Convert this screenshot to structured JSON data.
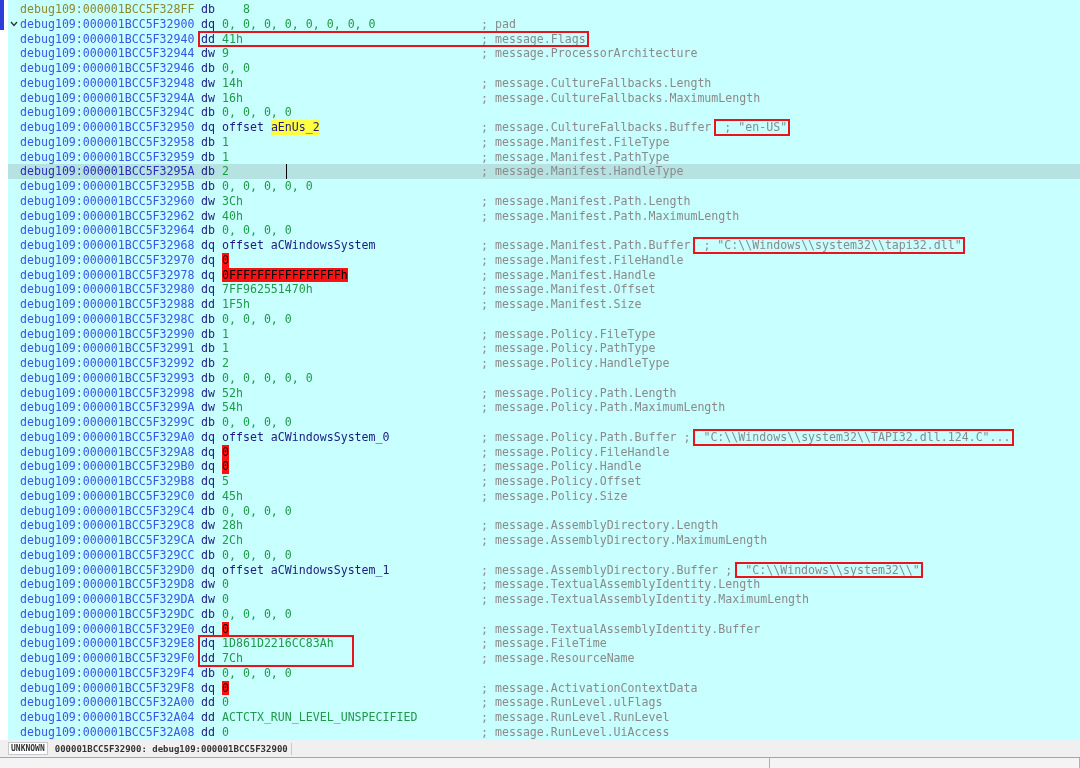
{
  "listing": [
    {
      "address": "debug109:000001BCC5F328FF",
      "mnemonic": "db",
      "operand": [
        {
          "text": "   8",
          "kind": "number"
        }
      ],
      "boxed_code": false,
      "boxed_comment": false,
      "boxed_string": false,
      "selected": false,
      "dimmed": true
    },
    {
      "address": "debug109:000001BCC5F32900",
      "mnemonic": "dq",
      "operand": [
        {
          "text": "0, 0, 0, 0, 0, 0, 0, 0",
          "kind": "number"
        }
      ],
      "comment": "; pad",
      "boxed_code": false,
      "boxed_comment": false,
      "boxed_string": false,
      "selected": false,
      "dimmed": false,
      "expanded": true
    },
    {
      "address": "debug109:000001BCC5F32940",
      "mnemonic": "dd",
      "operand": [
        {
          "text": "41h",
          "kind": "number"
        }
      ],
      "comment": "; message.Flags",
      "boxed_code": true,
      "boxed_comment": true,
      "boxed_string": false,
      "selected": false,
      "dimmed": false
    },
    {
      "address": "debug109:000001BCC5F32944",
      "mnemonic": "dw",
      "operand": [
        {
          "text": "9",
          "kind": "number"
        }
      ],
      "comment": "; message.ProcessorArchitecture",
      "boxed_code": false,
      "boxed_comment": false,
      "boxed_string": false,
      "selected": false,
      "dimmed": false
    },
    {
      "address": "debug109:000001BCC5F32946",
      "mnemonic": "db",
      "operand": [
        {
          "text": "0, 0",
          "kind": "number"
        }
      ],
      "boxed_code": false,
      "boxed_comment": false,
      "boxed_string": false,
      "selected": false,
      "dimmed": false
    },
    {
      "address": "debug109:000001BCC5F32948",
      "mnemonic": "dw",
      "operand": [
        {
          "text": "14h",
          "kind": "number"
        }
      ],
      "comment": "; message.CultureFallbacks.Length",
      "boxed_code": false,
      "boxed_comment": false,
      "boxed_string": false,
      "selected": false,
      "dimmed": false
    },
    {
      "address": "debug109:000001BCC5F3294A",
      "mnemonic": "dw",
      "operand": [
        {
          "text": "16h",
          "kind": "number"
        }
      ],
      "comment": "; message.CultureFallbacks.MaximumLength",
      "boxed_code": false,
      "boxed_comment": false,
      "boxed_string": false,
      "selected": false,
      "dimmed": false
    },
    {
      "address": "debug109:000001BCC5F3294C",
      "mnemonic": "db",
      "operand": [
        {
          "text": "0, 0, 0, 0",
          "kind": "number"
        }
      ],
      "boxed_code": false,
      "boxed_comment": false,
      "boxed_string": false,
      "selected": false,
      "dimmed": false
    },
    {
      "address": "debug109:000001BCC5F32950",
      "mnemonic": "dq",
      "operand": [
        {
          "text": "offset",
          "kind": "name"
        },
        {
          "text": "aEnUs_2",
          "kind": "found"
        }
      ],
      "comment": "; message.CultureFallbacks.Buffer",
      "string": "; \"en-US\"",
      "boxed_code": false,
      "boxed_comment": false,
      "boxed_string": true,
      "selected": false,
      "dimmed": false
    },
    {
      "address": "debug109:000001BCC5F32958",
      "mnemonic": "db",
      "operand": [
        {
          "text": "1",
          "kind": "number"
        }
      ],
      "comment": "; message.Manifest.FileType",
      "boxed_code": false,
      "boxed_comment": false,
      "boxed_string": false,
      "selected": false,
      "dimmed": false
    },
    {
      "address": "debug109:000001BCC5F32959",
      "mnemonic": "db",
      "operand": [
        {
          "text": "1",
          "kind": "number"
        }
      ],
      "comment": "; message.Manifest.PathType",
      "boxed_code": false,
      "boxed_comment": false,
      "boxed_string": false,
      "selected": false,
      "dimmed": false
    },
    {
      "address": "debug109:000001BCC5F3295A",
      "mnemonic": "db",
      "operand": [
        {
          "text": "2",
          "kind": "number"
        }
      ],
      "comment": "; message.Manifest.HandleType",
      "boxed_code": false,
      "boxed_comment": false,
      "boxed_string": false,
      "selected": true,
      "dimmed": false
    },
    {
      "address": "debug109:000001BCC5F3295B",
      "mnemonic": "db",
      "operand": [
        {
          "text": "0, 0, 0, 0, 0",
          "kind": "number"
        }
      ],
      "boxed_code": false,
      "boxed_comment": false,
      "boxed_string": false,
      "selected": false,
      "dimmed": false
    },
    {
      "address": "debug109:000001BCC5F32960",
      "mnemonic": "dw",
      "operand": [
        {
          "text": "3Ch",
          "kind": "number"
        }
      ],
      "comment": "; message.Manifest.Path.Length",
      "boxed_code": false,
      "boxed_comment": false,
      "boxed_string": false,
      "selected": false,
      "dimmed": false
    },
    {
      "address": "debug109:000001BCC5F32962",
      "mnemonic": "dw",
      "operand": [
        {
          "text": "40h",
          "kind": "number"
        }
      ],
      "comment": "; message.Manifest.Path.MaximumLength",
      "boxed_code": false,
      "boxed_comment": false,
      "boxed_string": false,
      "selected": false,
      "dimmed": false
    },
    {
      "address": "debug109:000001BCC5F32964",
      "mnemonic": "db",
      "operand": [
        {
          "text": "0, 0, 0, 0",
          "kind": "number"
        }
      ],
      "boxed_code": false,
      "boxed_comment": false,
      "boxed_string": false,
      "selected": false,
      "dimmed": false
    },
    {
      "address": "debug109:000001BCC5F32968",
      "mnemonic": "dq",
      "operand": [
        {
          "text": "offset aCWindowsSystem",
          "kind": "name"
        }
      ],
      "comment": "; message.Manifest.Path.Buffer",
      "string": "; \"C:\\\\Windows\\\\system32\\\\tapi32.dll\"",
      "boxed_code": false,
      "boxed_comment": false,
      "boxed_string": true,
      "selected": false,
      "dimmed": false
    },
    {
      "address": "debug109:000001BCC5F32970",
      "mnemonic": "dq",
      "operand": [
        {
          "text": "0",
          "kind": "bad"
        }
      ],
      "comment": "; message.Manifest.FileHandle",
      "boxed_code": false,
      "boxed_comment": false,
      "boxed_string": false,
      "selected": false,
      "dimmed": false
    },
    {
      "address": "debug109:000001BCC5F32978",
      "mnemonic": "dq",
      "operand": [
        {
          "text": "0FFFFFFFFFFFFFFFFh",
          "kind": "bad"
        }
      ],
      "comment": "; message.Manifest.Handle",
      "boxed_code": false,
      "boxed_comment": false,
      "boxed_string": false,
      "selected": false,
      "dimmed": false
    },
    {
      "address": "debug109:000001BCC5F32980",
      "mnemonic": "dq",
      "operand": [
        {
          "text": "7FF962551470h",
          "kind": "number"
        }
      ],
      "comment": "; message.Manifest.Offset",
      "boxed_code": false,
      "boxed_comment": false,
      "boxed_string": false,
      "selected": false,
      "dimmed": false
    },
    {
      "address": "debug109:000001BCC5F32988",
      "mnemonic": "dd",
      "operand": [
        {
          "text": "1F5h",
          "kind": "number"
        }
      ],
      "comment": "; message.Manifest.Size",
      "boxed_code": false,
      "boxed_comment": false,
      "boxed_string": false,
      "selected": false,
      "dimmed": false
    },
    {
      "address": "debug109:000001BCC5F3298C",
      "mnemonic": "db",
      "operand": [
        {
          "text": "0, 0, 0, 0",
          "kind": "number"
        }
      ],
      "boxed_code": false,
      "boxed_comment": false,
      "boxed_string": false,
      "selected": false,
      "dimmed": false
    },
    {
      "address": "debug109:000001BCC5F32990",
      "mnemonic": "db",
      "operand": [
        {
          "text": "1",
          "kind": "number"
        }
      ],
      "comment": "; message.Policy.FileType",
      "boxed_code": false,
      "boxed_comment": false,
      "boxed_string": false,
      "selected": false,
      "dimmed": false
    },
    {
      "address": "debug109:000001BCC5F32991",
      "mnemonic": "db",
      "operand": [
        {
          "text": "1",
          "kind": "number"
        }
      ],
      "comment": "; message.Policy.PathType",
      "boxed_code": false,
      "boxed_comment": false,
      "boxed_string": false,
      "selected": false,
      "dimmed": false
    },
    {
      "address": "debug109:000001BCC5F32992",
      "mnemonic": "db",
      "operand": [
        {
          "text": "2",
          "kind": "number"
        }
      ],
      "comment": "; message.Policy.HandleType",
      "boxed_code": false,
      "boxed_comment": false,
      "boxed_string": false,
      "selected": false,
      "dimmed": false
    },
    {
      "address": "debug109:000001BCC5F32993",
      "mnemonic": "db",
      "operand": [
        {
          "text": "0, 0, 0, 0, 0",
          "kind": "number"
        }
      ],
      "boxed_code": false,
      "boxed_comment": false,
      "boxed_string": false,
      "selected": false,
      "dimmed": false
    },
    {
      "address": "debug109:000001BCC5F32998",
      "mnemonic": "dw",
      "operand": [
        {
          "text": "52h",
          "kind": "number"
        }
      ],
      "comment": "; message.Policy.Path.Length",
      "boxed_code": false,
      "boxed_comment": false,
      "boxed_string": false,
      "selected": false,
      "dimmed": false
    },
    {
      "address": "debug109:000001BCC5F3299A",
      "mnemonic": "dw",
      "operand": [
        {
          "text": "54h",
          "kind": "number"
        }
      ],
      "comment": "; message.Policy.Path.MaximumLength",
      "boxed_code": false,
      "boxed_comment": false,
      "boxed_string": false,
      "selected": false,
      "dimmed": false
    },
    {
      "address": "debug109:000001BCC5F3299C",
      "mnemonic": "db",
      "operand": [
        {
          "text": "0, 0, 0, 0",
          "kind": "number"
        }
      ],
      "boxed_code": false,
      "boxed_comment": false,
      "boxed_string": false,
      "selected": false,
      "dimmed": false
    },
    {
      "address": "debug109:000001BCC5F329A0",
      "mnemonic": "dq",
      "operand": [
        {
          "text": "offset aCWindowsSystem_0",
          "kind": "name"
        }
      ],
      "comment": "; message.Policy.Path.Buffer ;",
      "string": "\"C:\\\\Windows\\\\system32\\\\TAPI32.dll.124.C\"...",
      "boxed_code": false,
      "boxed_comment": false,
      "boxed_string": true,
      "selected": false,
      "dimmed": false
    },
    {
      "address": "debug109:000001BCC5F329A8",
      "mnemonic": "dq",
      "operand": [
        {
          "text": "0",
          "kind": "bad"
        }
      ],
      "comment": "; message.Policy.FileHandle",
      "boxed_code": false,
      "boxed_comment": false,
      "boxed_string": false,
      "selected": false,
      "dimmed": false
    },
    {
      "address": "debug109:000001BCC5F329B0",
      "mnemonic": "dq",
      "operand": [
        {
          "text": "0",
          "kind": "bad"
        }
      ],
      "comment": "; message.Policy.Handle",
      "boxed_code": false,
      "boxed_comment": false,
      "boxed_string": false,
      "selected": false,
      "dimmed": false
    },
    {
      "address": "debug109:000001BCC5F329B8",
      "mnemonic": "dq",
      "operand": [
        {
          "text": "5",
          "kind": "number"
        }
      ],
      "comment": "; message.Policy.Offset",
      "boxed_code": false,
      "boxed_comment": false,
      "boxed_string": false,
      "selected": false,
      "dimmed": false
    },
    {
      "address": "debug109:000001BCC5F329C0",
      "mnemonic": "dd",
      "operand": [
        {
          "text": "45h",
          "kind": "number"
        }
      ],
      "comment": "; message.Policy.Size",
      "boxed_code": false,
      "boxed_comment": false,
      "boxed_string": false,
      "selected": false,
      "dimmed": false
    },
    {
      "address": "debug109:000001BCC5F329C4",
      "mnemonic": "db",
      "operand": [
        {
          "text": "0, 0, 0, 0",
          "kind": "number"
        }
      ],
      "boxed_code": false,
      "boxed_comment": false,
      "boxed_string": false,
      "selected": false,
      "dimmed": false
    },
    {
      "address": "debug109:000001BCC5F329C8",
      "mnemonic": "dw",
      "operand": [
        {
          "text": "28h",
          "kind": "number"
        }
      ],
      "comment": "; message.AssemblyDirectory.Length",
      "boxed_code": false,
      "boxed_comment": false,
      "boxed_string": false,
      "selected": false,
      "dimmed": false
    },
    {
      "address": "debug109:000001BCC5F329CA",
      "mnemonic": "dw",
      "operand": [
        {
          "text": "2Ch",
          "kind": "number"
        }
      ],
      "comment": "; message.AssemblyDirectory.MaximumLength",
      "boxed_code": false,
      "boxed_comment": false,
      "boxed_string": false,
      "selected": false,
      "dimmed": false
    },
    {
      "address": "debug109:000001BCC5F329CC",
      "mnemonic": "db",
      "operand": [
        {
          "text": "0, 0, 0, 0",
          "kind": "number"
        }
      ],
      "boxed_code": false,
      "boxed_comment": false,
      "boxed_string": false,
      "selected": false,
      "dimmed": false
    },
    {
      "address": "debug109:000001BCC5F329D0",
      "mnemonic": "dq",
      "operand": [
        {
          "text": "offset aCWindowsSystem_1",
          "kind": "name"
        }
      ],
      "comment": "; message.AssemblyDirectory.Buffer ;",
      "string": "\"C:\\\\Windows\\\\system32\\\\\"",
      "boxed_code": false,
      "boxed_comment": false,
      "boxed_string": true,
      "selected": false,
      "dimmed": false
    },
    {
      "address": "debug109:000001BCC5F329D8",
      "mnemonic": "dw",
      "operand": [
        {
          "text": "0",
          "kind": "number"
        }
      ],
      "comment": "; message.TextualAssemblyIdentity.Length",
      "boxed_code": false,
      "boxed_comment": false,
      "boxed_string": false,
      "selected": false,
      "dimmed": false
    },
    {
      "address": "debug109:000001BCC5F329DA",
      "mnemonic": "dw",
      "operand": [
        {
          "text": "0",
          "kind": "number"
        }
      ],
      "comment": "; message.TextualAssemblyIdentity.MaximumLength",
      "boxed_code": false,
      "boxed_comment": false,
      "boxed_string": false,
      "selected": false,
      "dimmed": false
    },
    {
      "address": "debug109:000001BCC5F329DC",
      "mnemonic": "db",
      "operand": [
        {
          "text": "0, 0, 0, 0",
          "kind": "number"
        }
      ],
      "boxed_code": false,
      "boxed_comment": false,
      "boxed_string": false,
      "selected": false,
      "dimmed": false
    },
    {
      "address": "debug109:000001BCC5F329E0",
      "mnemonic": "dq",
      "operand": [
        {
          "text": "0",
          "kind": "bad"
        }
      ],
      "comment": "; message.TextualAssemblyIdentity.Buffer",
      "boxed_code": false,
      "boxed_comment": false,
      "boxed_string": false,
      "selected": false,
      "dimmed": false
    },
    {
      "address": "debug109:000001BCC5F329E8",
      "mnemonic": "dq",
      "operand": [
        {
          "text": "1D861D2216CC83Ah",
          "kind": "number"
        }
      ],
      "comment": "; message.FileTime",
      "boxed_code": true,
      "boxed_comment": false,
      "boxed_string": false,
      "selected": false,
      "dimmed": false
    },
    {
      "address": "debug109:000001BCC5F329F0",
      "mnemonic": "dd",
      "operand": [
        {
          "text": "7Ch",
          "kind": "number"
        }
      ],
      "comment": "; message.ResourceName",
      "boxed_code": true,
      "boxed_comment": false,
      "boxed_string": false,
      "selected": false,
      "dimmed": false
    },
    {
      "address": "debug109:000001BCC5F329F4",
      "mnemonic": "db",
      "operand": [
        {
          "text": "0, 0, 0, 0",
          "kind": "number"
        }
      ],
      "boxed_code": false,
      "boxed_comment": false,
      "boxed_string": false,
      "selected": false,
      "dimmed": false
    },
    {
      "address": "debug109:000001BCC5F329F8",
      "mnemonic": "dq",
      "operand": [
        {
          "text": "0",
          "kind": "bad"
        }
      ],
      "comment": "; message.ActivationContextData",
      "boxed_code": false,
      "boxed_comment": false,
      "boxed_string": false,
      "selected": false,
      "dimmed": false
    },
    {
      "address": "debug109:000001BCC5F32A00",
      "mnemonic": "dd",
      "operand": [
        {
          "text": "0",
          "kind": "number"
        }
      ],
      "comment": "; message.RunLevel.ulFlags",
      "boxed_code": false,
      "boxed_comment": false,
      "boxed_string": false,
      "selected": false,
      "dimmed": false
    },
    {
      "address": "debug109:000001BCC5F32A04",
      "mnemonic": "dd",
      "operand": [
        {
          "text": "ACTCTX_RUN_LEVEL_UNSPECIFIED",
          "kind": "number"
        }
      ],
      "comment": "; message.RunLevel.RunLevel",
      "boxed_code": false,
      "boxed_comment": false,
      "boxed_string": false,
      "selected": false,
      "dimmed": false
    },
    {
      "address": "debug109:000001BCC5F32A08",
      "mnemonic": "dd",
      "operand": [
        {
          "text": "0",
          "kind": "number"
        }
      ],
      "comment": "; message.RunLevel.UiAccess",
      "boxed_code": false,
      "boxed_comment": false,
      "boxed_string": false,
      "selected": false,
      "dimmed": false
    }
  ],
  "status_bar": {
    "type": "UNKNOWN",
    "location": "000001BCC5F32900: debug109:000001BCC5F32900"
  }
}
